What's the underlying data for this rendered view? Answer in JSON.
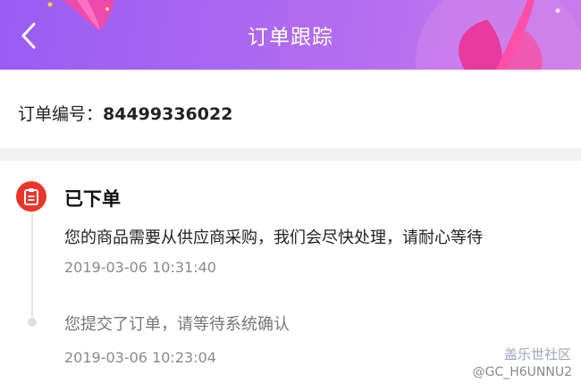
{
  "header": {
    "title": "订单跟踪",
    "back_icon": "chevron-left-icon",
    "background_start": "#9a5cf2",
    "background_end": "#c97cec"
  },
  "order": {
    "label": "订单编号：",
    "number": "84499336022"
  },
  "tracking": {
    "steps": [
      {
        "title": "已下单",
        "description": "您的商品需要从供应商采购，我们会尽快处理，请耐心等待",
        "time": "2019-03-06 10:31:40",
        "icon": "order-placed-icon",
        "icon_color": "#e8362a"
      },
      {
        "description": "您提交了订单，请等待系统确认",
        "time": "2019-03-06 10:23:04"
      }
    ]
  },
  "watermark": {
    "title": "盖乐世社区",
    "user": "@GC_H6UNNU2"
  }
}
